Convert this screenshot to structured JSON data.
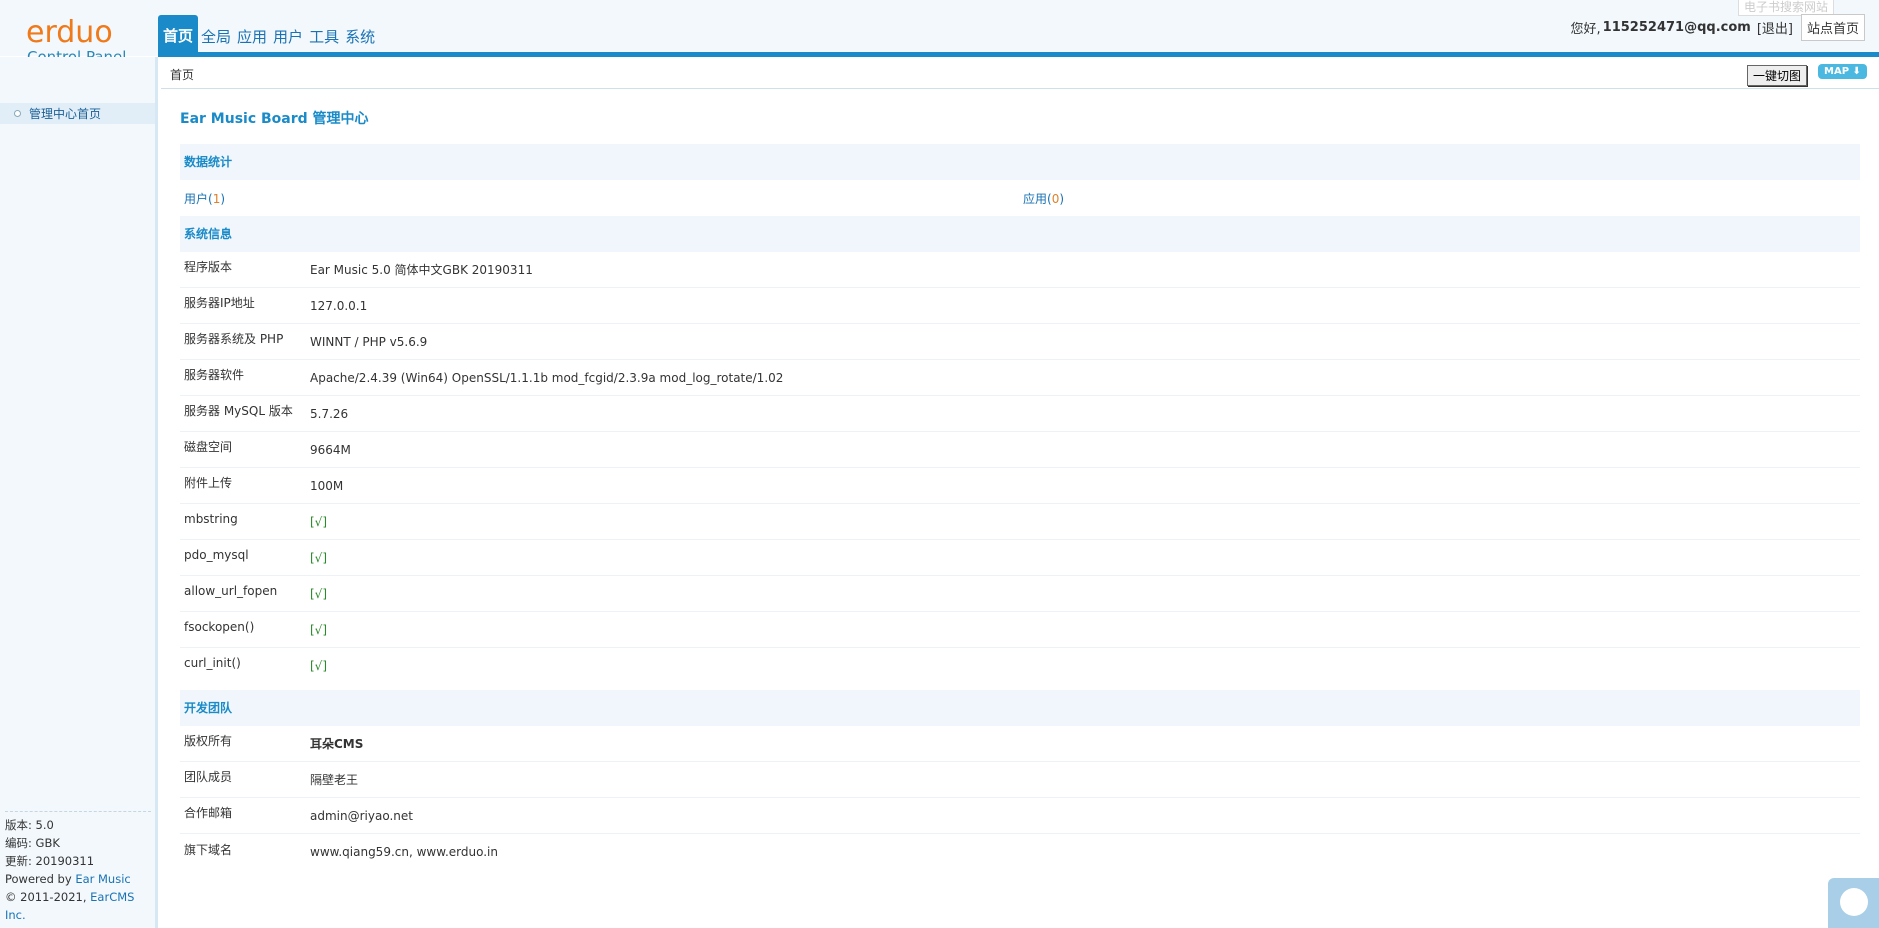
{
  "header": {
    "logo_brand": "erduo",
    "logo_sub": "Control Panel",
    "ghost_link": "电子书搜索网站",
    "nav": [
      {
        "label": "首页",
        "active": true
      },
      {
        "label": "全局",
        "active": false
      },
      {
        "label": "应用",
        "active": false
      },
      {
        "label": "用户",
        "active": false
      },
      {
        "label": "工具",
        "active": false
      },
      {
        "label": "系统",
        "active": false
      }
    ],
    "greeting": "您好,",
    "email": "115252471@qq.com",
    "logout": "[退出]",
    "site_home": "站点首页"
  },
  "sidebar": {
    "menu_item": "管理中心首页",
    "footer": {
      "version": "版本: 5.0",
      "encoding": "编码: GBK",
      "updated": "更新: 20190311",
      "powered_prefix": "Powered by ",
      "powered_link": "Ear Music",
      "copyright_prefix": "© 2011-2021, ",
      "copyright_link": "EarCMS Inc."
    }
  },
  "crumbbar": {
    "crumb": "首页",
    "onekey": "一键切图",
    "map": "MAP"
  },
  "main": {
    "title": "Ear Music Board 管理中心",
    "stats_head": "数据统计",
    "stats": {
      "users_label": "用户",
      "users_open": "(",
      "users_count": "1",
      "users_close": ")",
      "apps_label": "应用",
      "apps_open": "(",
      "apps_count": "0",
      "apps_close": ")"
    },
    "sysinfo_head": "系统信息",
    "sysinfo": [
      {
        "k": "程序版本",
        "v": "Ear Music 5.0 简体中文GBK 20190311"
      },
      {
        "k": "服务器IP地址",
        "v": "127.0.0.1"
      },
      {
        "k": "服务器系统及 PHP",
        "v": "WINNT / PHP v5.6.9"
      },
      {
        "k": "服务器软件",
        "v": "Apache/2.4.39 (Win64) OpenSSL/1.1.1b mod_fcgid/2.3.9a mod_log_rotate/1.02"
      },
      {
        "k": "服务器 MySQL 版本",
        "v": "5.7.26"
      },
      {
        "k": "磁盘空间",
        "v": "9664M"
      },
      {
        "k": "附件上传",
        "v": "100M"
      },
      {
        "k": "mbstring",
        "v": "[√]"
      },
      {
        "k": "pdo_mysql",
        "v": "[√]"
      },
      {
        "k": "allow_url_fopen",
        "v": "[√]"
      },
      {
        "k": "fsockopen()",
        "v": "[√]"
      },
      {
        "k": "curl_init()",
        "v": "[√]"
      }
    ],
    "team_head": "开发团队",
    "team": [
      {
        "k": "版权所有",
        "v": "耳朵CMS"
      },
      {
        "k": "团队成员",
        "v": "隔壁老王"
      },
      {
        "k": "合作邮箱",
        "v": "admin@riyao.net"
      },
      {
        "k": "旗下域名",
        "v": "www.qiang59.cn, www.erduo.in"
      }
    ]
  },
  "colors": {
    "accent": "#1a8bc8",
    "brand_orange": "#f0791a",
    "ok_green": "#2a8a2a",
    "count_orange": "#e0802a"
  },
  "icons": {
    "sidebar_bullet": "circle-bullet-icon",
    "map_arrow": "arrow-down-icon",
    "chat": "chat-bubble-icon"
  }
}
